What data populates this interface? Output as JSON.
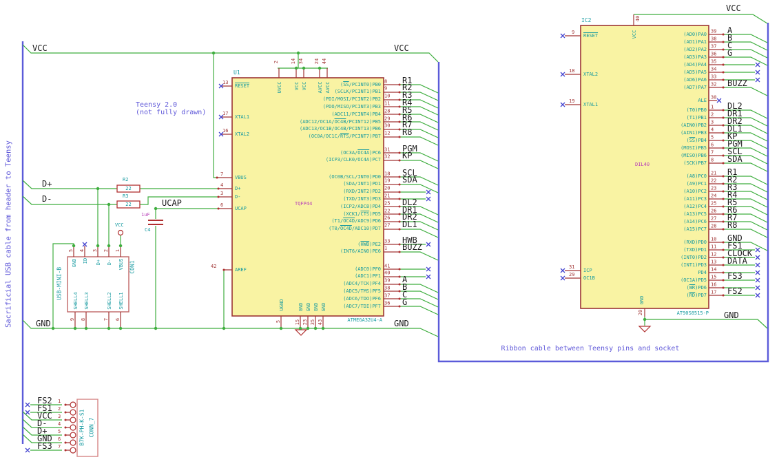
{
  "labels": {
    "vcc": "VCC",
    "gnd": "GND",
    "d_plus": "D+",
    "d_minus": "D-",
    "ucap": "UCAP"
  },
  "notes": {
    "teensy_line1": "Teensy 2.0",
    "teensy_line2": "(not fully drawn)",
    "usb_cable": "Sacrificial USB cable from header to Teensy",
    "ribbon_cable": "Ribbon cable between Teensy pins and socket"
  },
  "u1": {
    "ref": "U1",
    "value": "ATMEGA32U4-A",
    "footprint": "TQFP44",
    "left_pins": [
      {
        "num": "13",
        "name": "~RESET~"
      },
      {
        "num": "17",
        "name": "XTAL1"
      },
      {
        "num": "16",
        "name": "XTAL2"
      },
      {
        "num": "7",
        "name": "VBUS"
      },
      {
        "num": "4",
        "name": "D+"
      },
      {
        "num": "3",
        "name": "D-"
      },
      {
        "num": "6",
        "name": "UCAP"
      },
      {
        "num": "42",
        "name": "AREF"
      }
    ],
    "top_pins": [
      {
        "num": "2",
        "name": "UVCC"
      },
      {
        "num": "14",
        "name": "VCC"
      },
      {
        "num": "34",
        "name": "VCC"
      },
      {
        "num": "24",
        "name": "AVCC"
      },
      {
        "num": "44",
        "name": "AVCC"
      }
    ],
    "bottom_pins": [
      {
        "num": "5",
        "name": "UGND"
      },
      {
        "num": "15",
        "name": "GND"
      },
      {
        "num": "23",
        "name": "GND"
      },
      {
        "num": "35",
        "name": "GND"
      },
      {
        "num": "43",
        "name": "GND"
      }
    ],
    "rows_pb": [
      {
        "num": "8",
        "name": "(~SS~/PCINT0)PB0",
        "net": "R1"
      },
      {
        "num": "9",
        "name": "(SCLK/PCINT1)PB1",
        "net": "R2"
      },
      {
        "num": "10",
        "name": "(PDI/MOSI/PCINT2)PB2",
        "net": "R3"
      },
      {
        "num": "11",
        "name": "(PDO/MISO/PCINT3)PB3",
        "net": "R4"
      },
      {
        "num": "28",
        "name": "(ADC11/PCINT4)PB4",
        "net": "R5"
      },
      {
        "num": "29",
        "name": "(ADC12/OC1A/~OC4B~/PCINT12)PB5",
        "net": "R6"
      },
      {
        "num": "30",
        "name": "(ADC13/OC1B/OC4B/PCINT13)PB6",
        "net": "R7"
      },
      {
        "num": "12",
        "name": "(OC0A/OC1C/~RTS~/PCINT7)PB7",
        "net": "R8"
      }
    ],
    "rows_pc": [
      {
        "num": "31",
        "name": "(OC3A/~OC4A~)PC6",
        "net": "PGM"
      },
      {
        "num": "32",
        "name": "(ICP3/CLK0/OC4A)PC7",
        "net": "KP"
      }
    ],
    "rows_pd": [
      {
        "num": "18",
        "name": "(OC0B/SCL/INT0)PD0",
        "net": "SCL"
      },
      {
        "num": "19",
        "name": "(SDA/INT1)PD1",
        "net": "SDA"
      },
      {
        "num": "20",
        "name": "(RXD/INT2)PD2",
        "net": ""
      },
      {
        "num": "21",
        "name": "(TXD/INT3)PD3",
        "net": ""
      },
      {
        "num": "25",
        "name": "(ICP2/ADC8)PD4",
        "net": "DL2"
      },
      {
        "num": "22",
        "name": "(XCK1/~CTS~)PD5",
        "net": "DR1"
      },
      {
        "num": "26",
        "name": "(T1/~OC4D~/ADC9)PD6",
        "net": "DR2"
      },
      {
        "num": "27",
        "name": "(T0/~OC4D~/ADC10)PD7",
        "net": "DL1"
      }
    ],
    "rows_pe": [
      {
        "num": "33",
        "name": "(~HWB~)PE2",
        "net": "HWB"
      },
      {
        "num": "1",
        "name": "(INT6/AIN0)PE6",
        "net": "BUZZ"
      }
    ],
    "rows_pf": [
      {
        "num": "41",
        "name": "(ADC0)PF0",
        "net": ""
      },
      {
        "num": "40",
        "name": "(ADC1)PF1",
        "net": ""
      },
      {
        "num": "39",
        "name": "(ADC4/TCK)PF4",
        "net": "A"
      },
      {
        "num": "38",
        "name": "(ADC5/TMS)PF5",
        "net": "B"
      },
      {
        "num": "37",
        "name": "(ADC6/TDO)PF6",
        "net": "C"
      },
      {
        "num": "36",
        "name": "(ADC7/TDI)PF7",
        "net": "G"
      }
    ]
  },
  "r2": {
    "ref": "R2",
    "value": "22"
  },
  "r3": {
    "ref": "R3",
    "value": "22"
  },
  "c4": {
    "ref": "C4",
    "value": "1uF"
  },
  "usb": {
    "ref": "CON1",
    "value": "USB-MINI-B",
    "top_pins": [
      {
        "num": "5",
        "name": "GND"
      },
      {
        "num": "4",
        "name": "ID"
      },
      {
        "num": "3",
        "name": "D+"
      },
      {
        "num": "2",
        "name": "D-"
      },
      {
        "num": "1",
        "name": "VBUS"
      }
    ],
    "bottom_pins": [
      {
        "num": "9",
        "name": "SHELL4"
      },
      {
        "num": "8",
        "name": "SHELL3"
      },
      {
        "num": "7",
        "name": "SHELL2"
      },
      {
        "num": "6",
        "name": "SHELL1"
      }
    ]
  },
  "conn7": {
    "ref": "CONN_7",
    "value": "B7K-PH-K-S1",
    "rows": [
      {
        "num": "1",
        "label": "FS2"
      },
      {
        "num": "2",
        "label": "FS1"
      },
      {
        "num": "3",
        "label": "VCC"
      },
      {
        "num": "4",
        "label": "D-"
      },
      {
        "num": "5",
        "label": "D+"
      },
      {
        "num": "6",
        "label": "GND"
      },
      {
        "num": "7",
        "label": "FS3"
      }
    ]
  },
  "ic2": {
    "ref": "IC2",
    "value": "AT90S8515-P",
    "footprint": "DIL40",
    "top_pin": {
      "num": "40",
      "name": "VCC"
    },
    "bottom_pin": {
      "num": "20",
      "name": "GND"
    },
    "left_pins": [
      {
        "num": "9",
        "name": "~RESET~"
      },
      {
        "num": "18",
        "name": "XTAL2"
      },
      {
        "num": "19",
        "name": "XTAL1"
      },
      {
        "num": "31",
        "name": "ICP"
      },
      {
        "num": "29",
        "name": "OC1B"
      }
    ],
    "rows_pa": [
      {
        "num": "39",
        "name": "(AD0)PA0",
        "net": "A"
      },
      {
        "num": "38",
        "name": "(AD1)PA1",
        "net": "B"
      },
      {
        "num": "37",
        "name": "(AD2)PA2",
        "net": "C"
      },
      {
        "num": "36",
        "name": "(AD3)PA3",
        "net": "G"
      },
      {
        "num": "35",
        "name": "(AD4)PA4",
        "net": ""
      },
      {
        "num": "34",
        "name": "(AD5)PA5",
        "net": ""
      },
      {
        "num": "33",
        "name": "(AD6)PA6",
        "net": ""
      },
      {
        "num": "32",
        "name": "(AD7)PA7",
        "net": "BUZZ"
      }
    ],
    "row_ale": [
      {
        "num": "30",
        "name": "ALE",
        "net": ""
      }
    ],
    "rows_pb": [
      {
        "num": "1",
        "name": "(T0)PB0",
        "net": "DL2"
      },
      {
        "num": "2",
        "name": "(T1)PB1",
        "net": "DR1"
      },
      {
        "num": "3",
        "name": "(AIN0)PB2",
        "net": "DR2"
      },
      {
        "num": "4",
        "name": "(AIN1)PB3",
        "net": "DL1"
      },
      {
        "num": "5",
        "name": "(~SS~)PB4",
        "net": "KP"
      },
      {
        "num": "6",
        "name": "(MOSI)PB5",
        "net": "PGM"
      },
      {
        "num": "7",
        "name": "(MISO)PB6",
        "net": "SCL"
      },
      {
        "num": "8",
        "name": "(SCK)PB7",
        "net": "SDA"
      }
    ],
    "rows_pc": [
      {
        "num": "21",
        "name": "(A8)PC0",
        "net": "R1"
      },
      {
        "num": "22",
        "name": "(A9)PC1",
        "net": "R2"
      },
      {
        "num": "23",
        "name": "(A10)PC2",
        "net": "R3"
      },
      {
        "num": "24",
        "name": "(A11)PC3",
        "net": "R4"
      },
      {
        "num": "25",
        "name": "(A12)PC4",
        "net": "R5"
      },
      {
        "num": "26",
        "name": "(A13)PC5",
        "net": "R6"
      },
      {
        "num": "27",
        "name": "(A14)PC6",
        "net": "R7"
      },
      {
        "num": "28",
        "name": "(A15)PC7",
        "net": "R8"
      }
    ],
    "rows_pd": [
      {
        "num": "10",
        "name": "(RXD)PD0",
        "net": "GND"
      },
      {
        "num": "11",
        "name": "(TXD)PD1",
        "net": "FS1"
      },
      {
        "num": "12",
        "name": "(INT0)PD2",
        "net": "CLOCK"
      },
      {
        "num": "13",
        "name": "(INT1)PD3",
        "net": "DATA"
      },
      {
        "num": "14",
        "name": "PD4",
        "net": ""
      },
      {
        "num": "15",
        "name": "(OC1A)PD5",
        "net": "FS3"
      },
      {
        "num": "16",
        "name": "(~WR~)PD6",
        "net": ""
      },
      {
        "num": "17",
        "name": "(~RD~)PD7",
        "net": "FS2"
      }
    ]
  }
}
